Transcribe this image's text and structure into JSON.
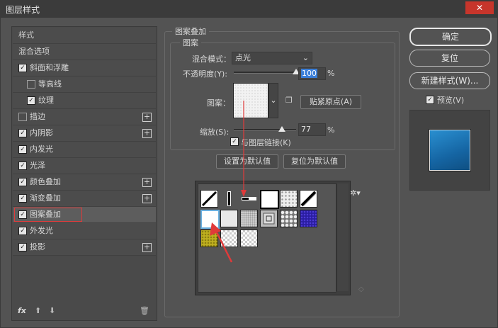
{
  "window": {
    "title": "图层样式",
    "close_glyph": "✕"
  },
  "sidebar": {
    "header": "样式",
    "items": [
      {
        "label": "混合选项",
        "checkbox": null,
        "indent": 0,
        "plus": false
      },
      {
        "label": "斜面和浮雕",
        "checkbox": true,
        "indent": 0,
        "plus": false
      },
      {
        "label": "等高线",
        "checkbox": false,
        "indent": 1,
        "plus": false
      },
      {
        "label": "纹理",
        "checkbox": true,
        "indent": 1,
        "plus": false
      },
      {
        "label": "描边",
        "checkbox": false,
        "indent": 0,
        "plus": true
      },
      {
        "label": "内阴影",
        "checkbox": true,
        "indent": 0,
        "plus": true
      },
      {
        "label": "内发光",
        "checkbox": true,
        "indent": 0,
        "plus": false
      },
      {
        "label": "光泽",
        "checkbox": true,
        "indent": 0,
        "plus": false
      },
      {
        "label": "颜色叠加",
        "checkbox": true,
        "indent": 0,
        "plus": true
      },
      {
        "label": "渐变叠加",
        "checkbox": true,
        "indent": 0,
        "plus": true
      },
      {
        "label": "图案叠加",
        "checkbox": true,
        "indent": 0,
        "plus": false,
        "selected": true
      },
      {
        "label": "外发光",
        "checkbox": true,
        "indent": 0,
        "plus": false
      },
      {
        "label": "投影",
        "checkbox": true,
        "indent": 0,
        "plus": true
      }
    ],
    "bottom": {
      "fx": "fx",
      "up": "⬆",
      "down": "⬇",
      "trash": "🗑"
    }
  },
  "panel": {
    "title": "图案叠加",
    "subtitle": "图案",
    "blend_mode_label": "混合模式：",
    "blend_mode_value": "点光",
    "opacity_label": "不透明度(Y):",
    "opacity_value": "100",
    "opacity_level": 100,
    "percent": "%",
    "pattern_label": "图案：",
    "snap_button": "贴紧原点(A)",
    "scale_label": "缩放(S):",
    "scale_value": "77",
    "scale_level": 77,
    "link_label": "与图层链接(K)",
    "link_checked": true,
    "set_default": "设置为默认值",
    "reset_default": "复位为默认值"
  },
  "right": {
    "ok": "确定",
    "reset": "复位",
    "new_style": "新建样式(W)...",
    "preview_label": "预览(V)",
    "preview_checked": true
  },
  "colors": {
    "accent_red": "#e03a3a",
    "highlight_blue": "#3a7ed8",
    "preview_blue": "#1a78bd"
  }
}
